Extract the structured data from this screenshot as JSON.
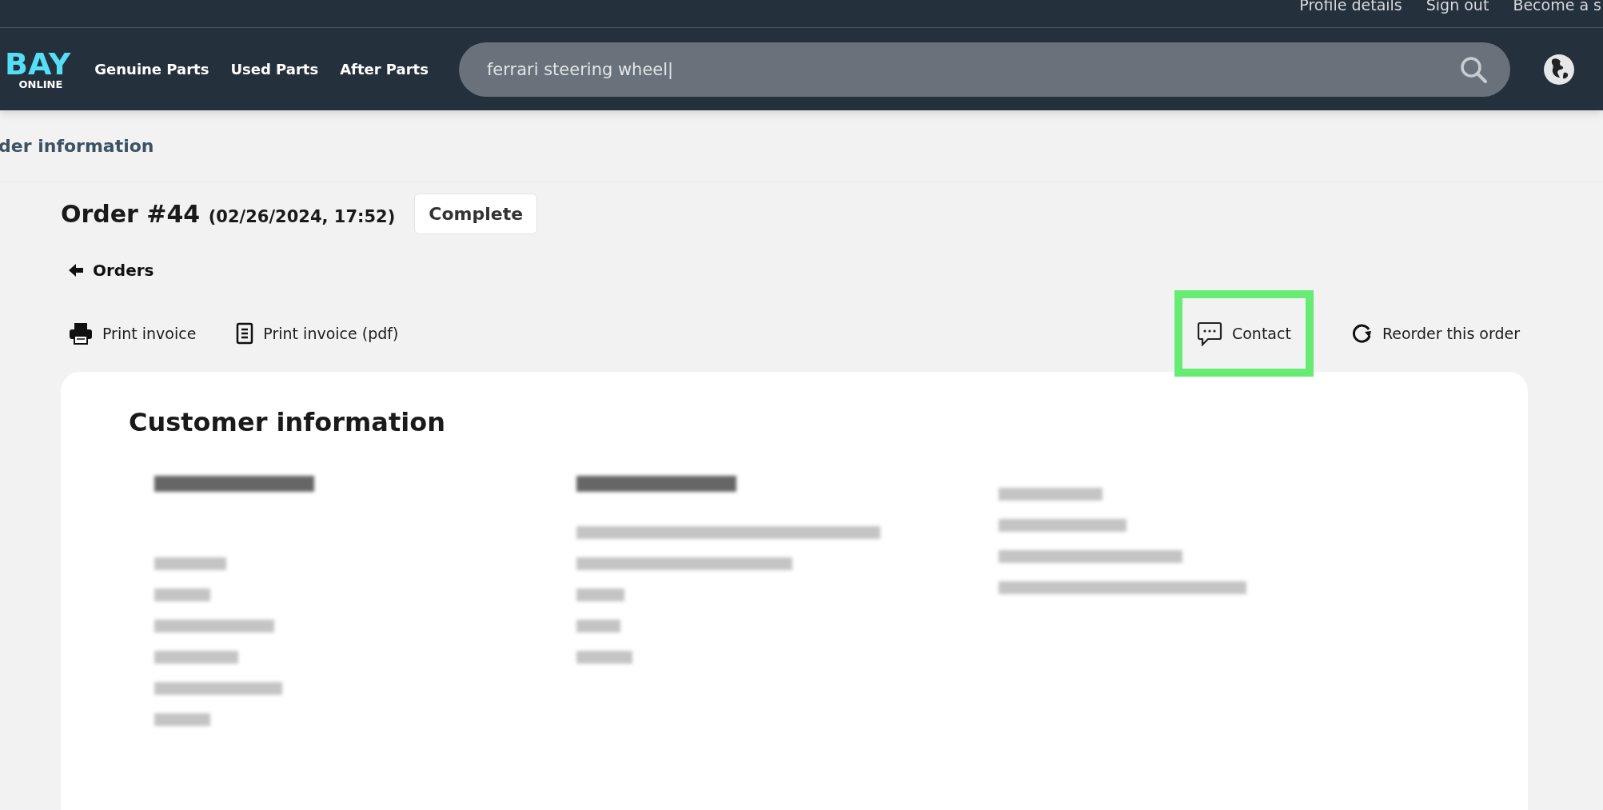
{
  "top_links": [
    "Profile details",
    "Sign out",
    "Become a s"
  ],
  "logo": {
    "word": "BAY",
    "subword": "ONLINE"
  },
  "nav": [
    "Genuine Parts",
    "Used Parts",
    "After Parts"
  ],
  "search": {
    "value": "ferrari steering wheel|"
  },
  "breadcrumb": "der information",
  "order": {
    "title": "Order #44",
    "date": "(02/26/2024, 17:52)",
    "status": "Complete"
  },
  "back_link": "Orders",
  "actions": [
    {
      "kind": "print",
      "label": "Print invoice",
      "highlighted": false
    },
    {
      "kind": "pdf",
      "label": "Print invoice (pdf)",
      "highlighted": false
    },
    {
      "kind": "contact",
      "label": "Contact",
      "highlighted": true
    },
    {
      "kind": "reorder",
      "label": "Reorder this order",
      "highlighted": false
    }
  ],
  "card": {
    "title": "Customer information"
  }
}
